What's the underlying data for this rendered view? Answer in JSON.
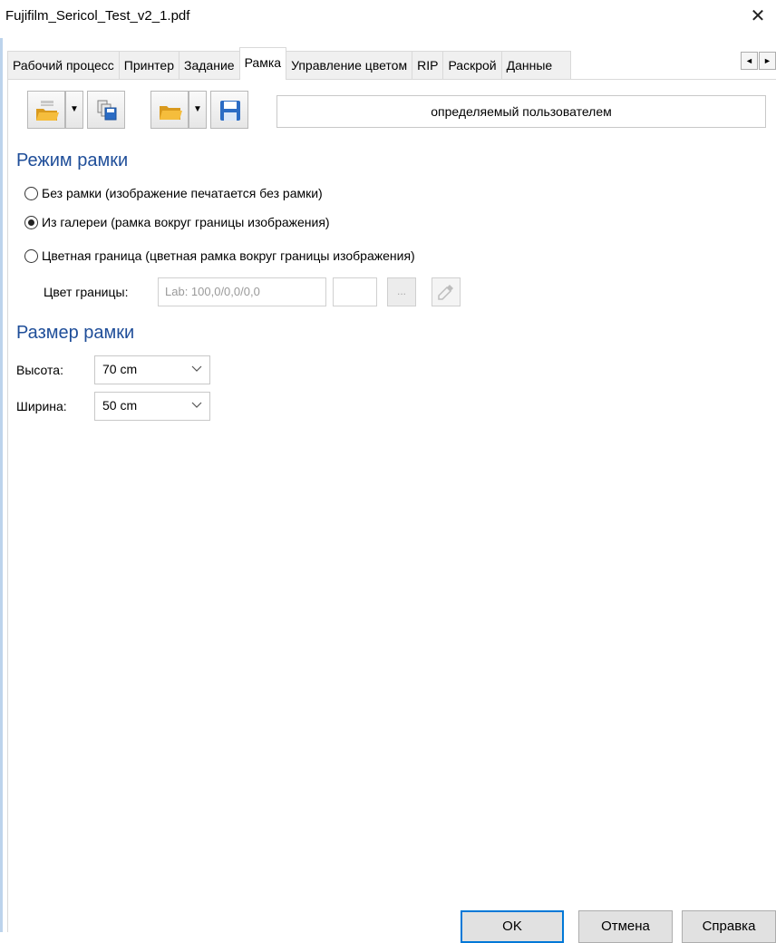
{
  "window": {
    "title": "Fujifilm_Sericol_Test_v2_1.pdf",
    "close": "✕"
  },
  "tabs": [
    {
      "label": "Рабочий процесс"
    },
    {
      "label": "Принтер"
    },
    {
      "label": "Задание"
    },
    {
      "label": "Рамка"
    },
    {
      "label": "Управление цветом"
    },
    {
      "label": "RIP"
    },
    {
      "label": "Раскрой"
    },
    {
      "label": "Данные"
    }
  ],
  "tab_scroll": {
    "left": "◄",
    "right": "►"
  },
  "toolbar": {
    "dropdown_arrow": "▼",
    "preset_name": "определяемый пользователем",
    "icons": [
      "open-folder-icon",
      "copy-icon",
      "folder-icon",
      "save-icon"
    ]
  },
  "frame_mode": {
    "heading": "Режим рамки",
    "options": [
      {
        "label": "Без рамки (изображение печатается без рамки)",
        "checked": false
      },
      {
        "label": "Из галереи (рамка вокруг границы изображения)",
        "checked": true
      },
      {
        "label": "Цветная граница (цветная рамка вокруг границы изображения)",
        "checked": false
      }
    ],
    "border_color_label": "Цвет границы:",
    "border_color_value": "Lab: 100,0/0,0/0,0",
    "browse_label": "...",
    "picker_icon": "eyedropper-icon"
  },
  "frame_size": {
    "heading": "Размер рамки",
    "height_label": "Высота:",
    "height_value": "70 cm",
    "width_label": "Ширина:",
    "width_value": "50 cm"
  },
  "buttons": {
    "ok": "OK",
    "cancel": "Отмена",
    "help": "Справка"
  },
  "colors": {
    "heading": "#1f4e99",
    "folder": "#f2b134",
    "save": "#2b6cc4",
    "accent": "#0078d7"
  }
}
